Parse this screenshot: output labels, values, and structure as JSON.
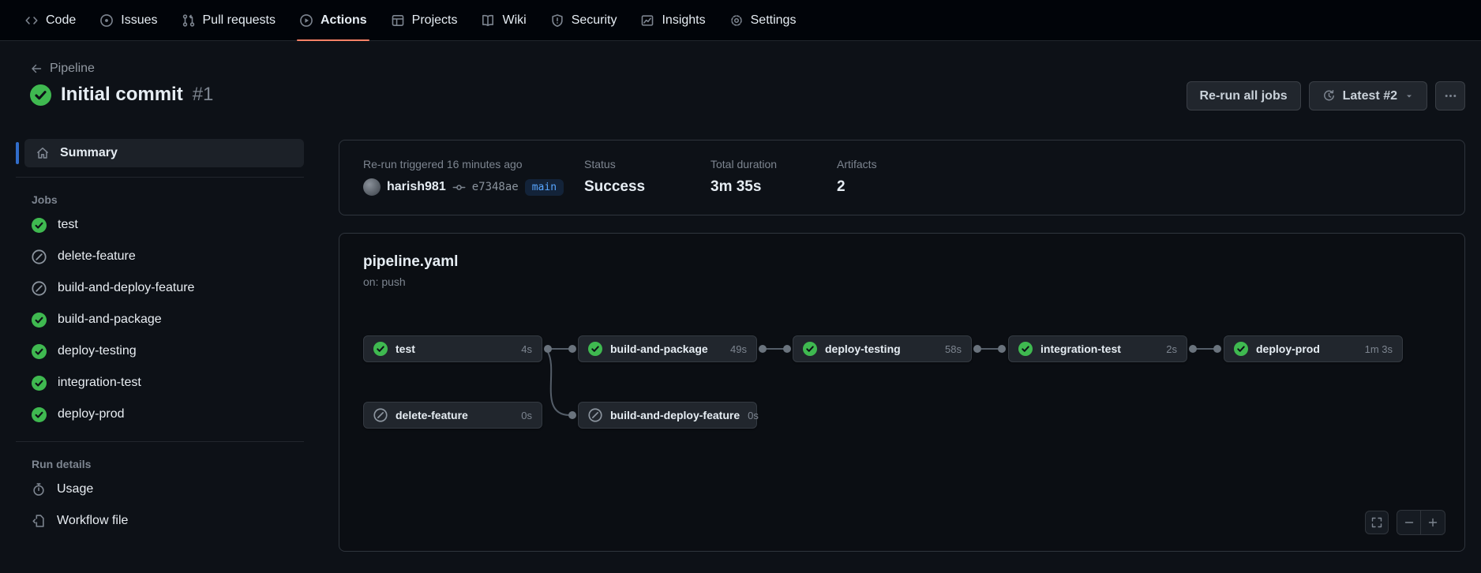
{
  "nav": {
    "items": [
      {
        "label": "Code",
        "icon": "code-icon",
        "selected": false
      },
      {
        "label": "Issues",
        "icon": "issue-opened-icon",
        "selected": false
      },
      {
        "label": "Pull requests",
        "icon": "git-pull-request-icon",
        "selected": false
      },
      {
        "label": "Actions",
        "icon": "play-circle-icon",
        "selected": true
      },
      {
        "label": "Projects",
        "icon": "table-icon",
        "selected": false
      },
      {
        "label": "Wiki",
        "icon": "book-icon",
        "selected": false
      },
      {
        "label": "Security",
        "icon": "shield-icon",
        "selected": false
      },
      {
        "label": "Insights",
        "icon": "graph-icon",
        "selected": false
      },
      {
        "label": "Settings",
        "icon": "gear-icon",
        "selected": false
      }
    ]
  },
  "header": {
    "breadcrumb": "Pipeline",
    "title": "Initial commit",
    "run_number": "#1",
    "run_status": "success",
    "rerun_button": "Re-run all jobs",
    "attempt_button": "Latest #2"
  },
  "sidebar": {
    "summary": "Summary",
    "jobs_heading": "Jobs",
    "jobs": [
      {
        "name": "test",
        "status": "success"
      },
      {
        "name": "delete-feature",
        "status": "skipped"
      },
      {
        "name": "build-and-deploy-feature",
        "status": "skipped"
      },
      {
        "name": "build-and-package",
        "status": "success"
      },
      {
        "name": "deploy-testing",
        "status": "success"
      },
      {
        "name": "integration-test",
        "status": "success"
      },
      {
        "name": "deploy-prod",
        "status": "success"
      }
    ],
    "run_details_heading": "Run details",
    "run_details": [
      {
        "label": "Usage",
        "icon": "stopwatch-icon"
      },
      {
        "label": "Workflow file",
        "icon": "file-code-icon"
      }
    ]
  },
  "summary_card": {
    "trigger_text": "Re-run triggered 16 minutes ago",
    "actor": "harish981",
    "commit_sha": "e7348ae",
    "branch": "main",
    "status_label": "Status",
    "status_value": "Success",
    "duration_label": "Total duration",
    "duration_value": "3m 35s",
    "artifacts_label": "Artifacts",
    "artifacts_value": "2"
  },
  "workflow_card": {
    "file_name": "pipeline.yaml",
    "trigger": "on: push",
    "nodes": [
      {
        "name": "test",
        "duration": "4s",
        "status": "success"
      },
      {
        "name": "build-and-package",
        "duration": "49s",
        "status": "success"
      },
      {
        "name": "deploy-testing",
        "duration": "58s",
        "status": "success"
      },
      {
        "name": "integration-test",
        "duration": "2s",
        "status": "success"
      },
      {
        "name": "deploy-prod",
        "duration": "1m 3s",
        "status": "success"
      },
      {
        "name": "delete-feature",
        "duration": "0s",
        "status": "skipped"
      },
      {
        "name": "build-and-deploy-feature",
        "duration": "0s",
        "status": "skipped"
      }
    ],
    "edges": [
      "test -> build-and-package",
      "test -> build-and-deploy-feature",
      "build-and-package -> deploy-testing",
      "deploy-testing -> integration-test",
      "integration-test -> deploy-prod"
    ]
  },
  "colors": {
    "page_bg": "#0d1117",
    "nav_bg": "#010409",
    "success_green": "#3fb950",
    "skipped_gray": "#8b949e",
    "tab_accent": "#f78166",
    "selected_accent": "#316dca",
    "branch_badge": "#58a6ff",
    "text_secondary": "#7d8590"
  }
}
